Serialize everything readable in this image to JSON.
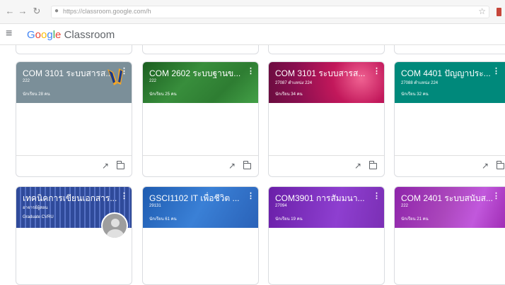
{
  "browser": {
    "url": "https://classroom.google.com/h"
  },
  "appbar": {
    "brand_google": [
      "G",
      "o",
      "o",
      "g",
      "l",
      "e"
    ],
    "product": "Classroom"
  },
  "cards": [
    {
      "title": "COM 3101 ระบบสารส...",
      "section": "222",
      "students": "นักเรียน 28 คน",
      "color": "#7b8f99"
    },
    {
      "title": "COM 2602 ระบบฐานข...",
      "section": "222",
      "students": "นักเรียน 25 คน",
      "color": "#2e7d32"
    },
    {
      "title": "COM 3101 ระบบสารส...",
      "section": "27087 ตำแหน่ง 224",
      "students": "นักเรียน 34 คน",
      "color": "#b0186c"
    },
    {
      "title": "COM 4401 ปัญญาประ...",
      "section": "27088 ตำแหน่ง 224",
      "students": "นักเรียน 32 คน",
      "color": "#00897b"
    },
    {
      "title": "เทคนิคการเขียนเอกสาร...",
      "section": "อาจารย์ผู้สอน",
      "students": "Graduate CVRU",
      "color": "#3f51a5"
    },
    {
      "title": "GSCI1102 IT เพื่อชีวิต ...",
      "section": "29131",
      "students": "นักเรียน 61 คน",
      "color": "#2d6cc0"
    },
    {
      "title": "COM3901 การสัมมนา...",
      "section": "27094",
      "students": "นักเรียน 19 คน",
      "color": "#7b2fb5"
    },
    {
      "title": "COM 2401 ระบบสนับส...",
      "section": "222",
      "students": "นักเรียน 21 คน",
      "color": "#9c27b0"
    }
  ]
}
